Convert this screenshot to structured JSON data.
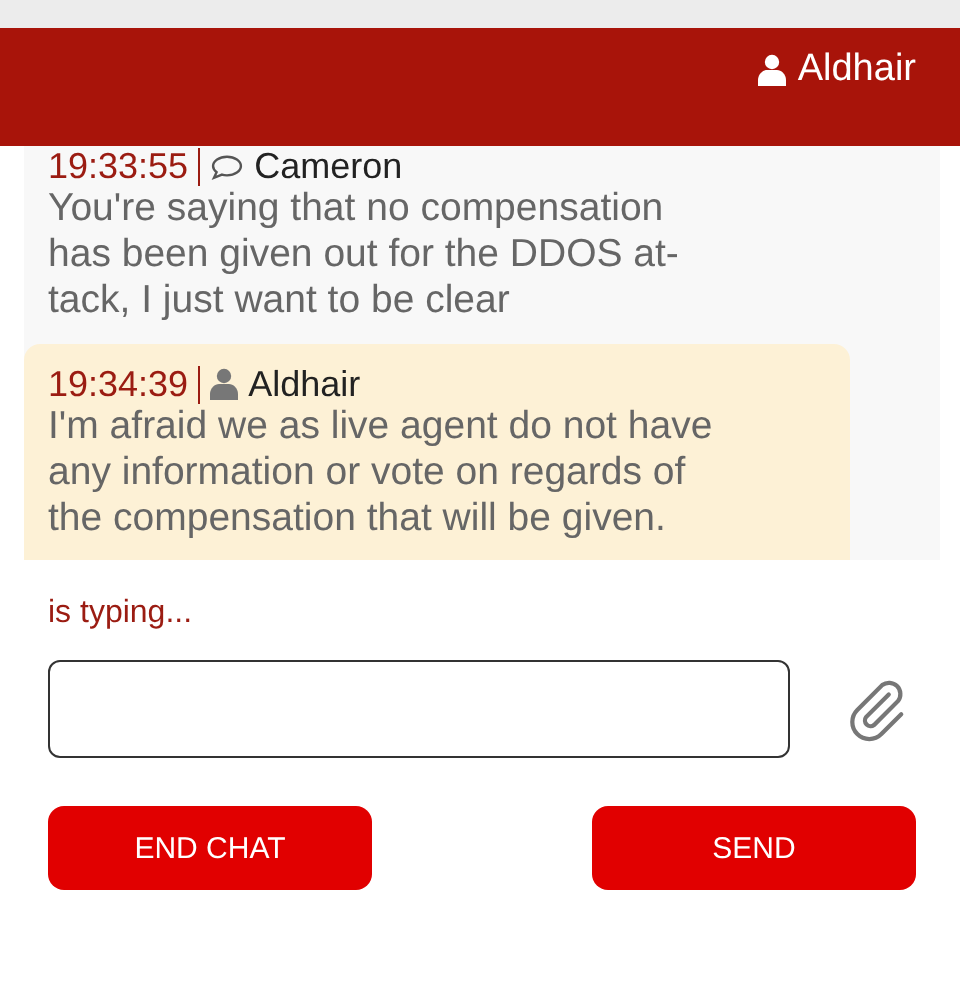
{
  "header": {
    "user": "Aldhair"
  },
  "messages": [
    {
      "kind": "customer",
      "time": "19:33:55",
      "sender": "Cameron",
      "highlighted": false,
      "lines": [
        "You're saying that no compensation",
        "has been given out for the DDOS at-",
        "tack, I just want to be clear"
      ]
    },
    {
      "kind": "agent",
      "time": "19:34:39",
      "sender": "Aldhair",
      "highlighted": true,
      "lines": [
        "I'm afraid we as live agent do not have",
        "any information or vote on regards of",
        "the compensation that will be given."
      ]
    }
  ],
  "typing_status": "is typing...",
  "buttons": [
    "END CHAT",
    "SEND"
  ]
}
